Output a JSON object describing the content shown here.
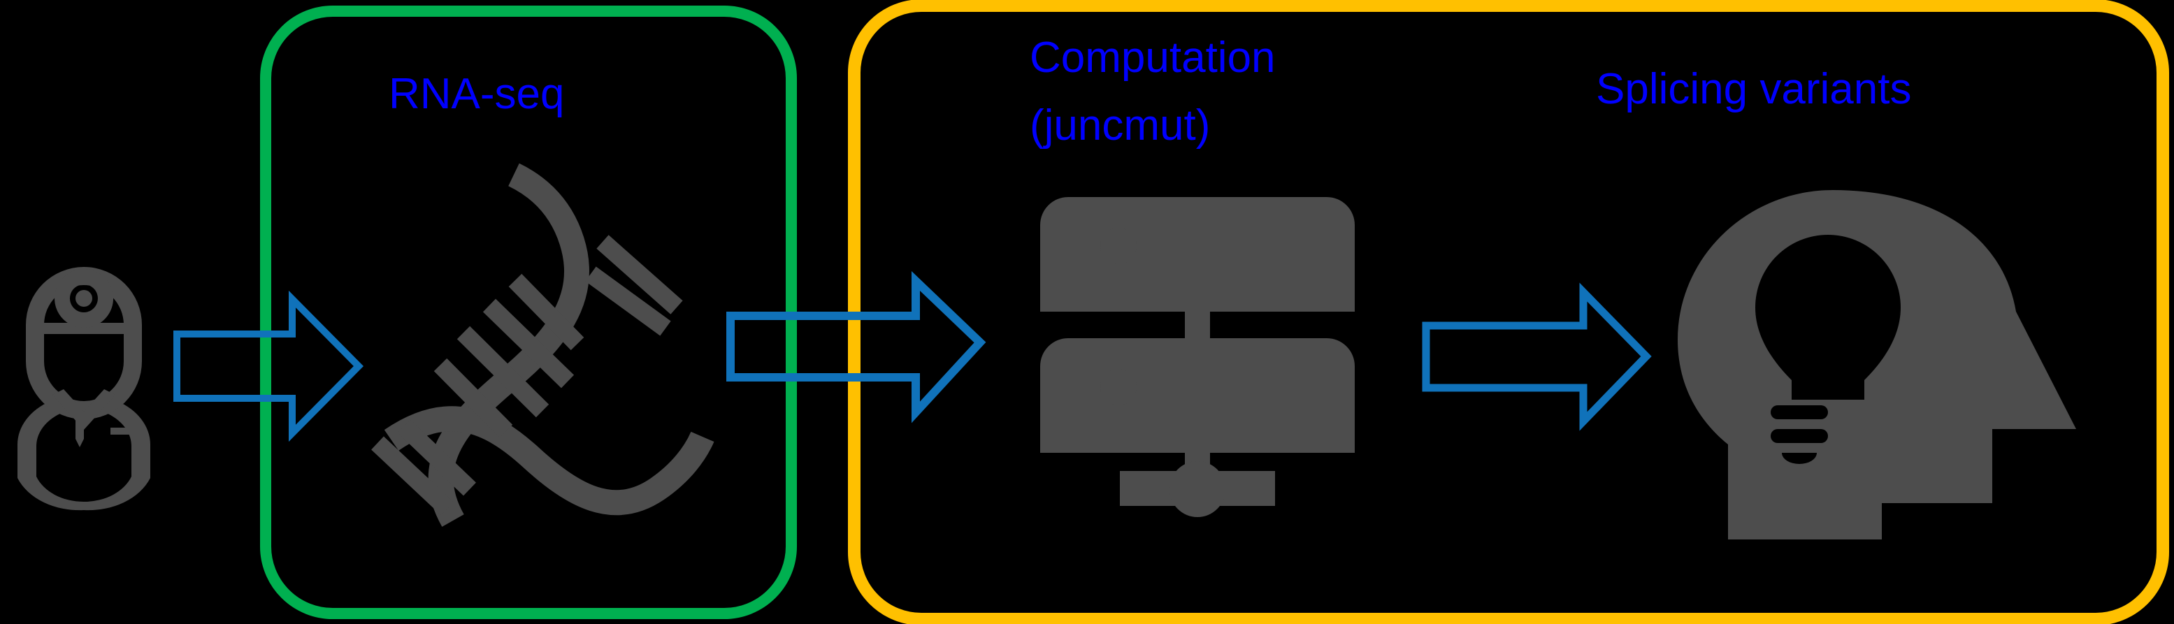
{
  "figure": {
    "title": "juncmut workflow overview",
    "background_color": "#000000"
  },
  "colors": {
    "background": "#000000",
    "box_rnaseq_border": "#00B050",
    "box_computation_border": "#FFC000",
    "label_text": "#0000FF",
    "arrow_stroke": "#1072BA",
    "icon_fill": "#4D4D4D"
  },
  "panels": [
    {
      "id": "rnaseq",
      "label": "RNA-seq",
      "border_color": "#00B050"
    },
    {
      "id": "computation",
      "label_line1": "Computation",
      "label_line2": "(juncmut)",
      "border_color": "#FFC000"
    }
  ],
  "labels": {
    "rnaseq": "RNA-seq",
    "computation_line1": "Computation",
    "computation_line2": "(juncmut)",
    "splicing_variants": "Splicing variants"
  },
  "icons": [
    {
      "name": "doctor-icon",
      "alt": "Clinician with head mirror"
    },
    {
      "name": "dna-helix-icon",
      "alt": "DNA double helix"
    },
    {
      "name": "server-stack-icon",
      "alt": "Two stacked servers with network connector"
    },
    {
      "name": "head-lightbulb-icon",
      "alt": "Head silhouette containing a lightbulb"
    }
  ],
  "arrows": [
    {
      "name": "arrow-doctor-to-dna",
      "direction": "right"
    },
    {
      "name": "arrow-dna-to-server",
      "direction": "right"
    },
    {
      "name": "arrow-server-to-head",
      "direction": "right"
    }
  ]
}
